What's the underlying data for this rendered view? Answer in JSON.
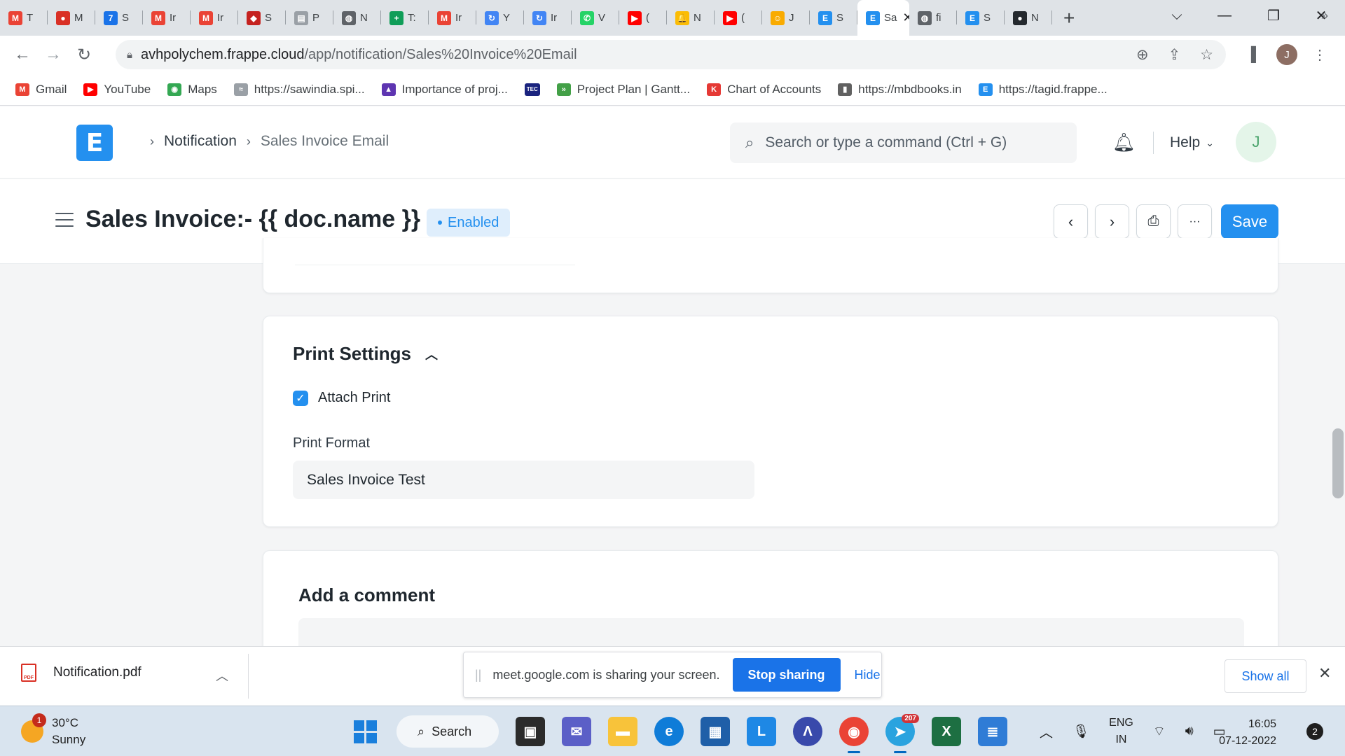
{
  "browser": {
    "tabs": [
      {
        "label": "T",
        "icon": "gmail-icon",
        "color": "#ea4335",
        "glyph": "M"
      },
      {
        "label": "M",
        "icon": "record-icon",
        "color": "#d93025",
        "glyph": "●"
      },
      {
        "label": "S",
        "icon": "calendar-icon",
        "color": "#1a73e8",
        "glyph": "7"
      },
      {
        "label": "Ir",
        "icon": "gmail-icon",
        "color": "#ea4335",
        "glyph": "M"
      },
      {
        "label": "Ir",
        "icon": "gmail-icon",
        "color": "#ea4335",
        "glyph": "M"
      },
      {
        "label": "S",
        "icon": "pin-icon",
        "color": "#c5221f",
        "glyph": "◆"
      },
      {
        "label": "P",
        "icon": "doc-icon",
        "color": "#9aa0a6",
        "glyph": "▤"
      },
      {
        "label": "N",
        "icon": "globe-icon",
        "color": "#5f6368",
        "glyph": "◍"
      },
      {
        "label": "T:",
        "icon": "plus-icon",
        "color": "#0f9d58",
        "glyph": "+"
      },
      {
        "label": "Ir",
        "icon": "gmail-icon",
        "color": "#ea4335",
        "glyph": "M"
      },
      {
        "label": "Y",
        "icon": "refresh-icon",
        "color": "#4285f4",
        "glyph": "↻"
      },
      {
        "label": "Ir",
        "icon": "refresh-icon",
        "color": "#4285f4",
        "glyph": "↻"
      },
      {
        "label": "V",
        "icon": "whatsapp-icon",
        "color": "#25d366",
        "glyph": "✆"
      },
      {
        "label": "(",
        "icon": "youtube-icon",
        "color": "#ff0000",
        "glyph": "▶"
      },
      {
        "label": "N",
        "icon": "bell-icon",
        "color": "#fbbc04",
        "glyph": "🔔"
      },
      {
        "label": "(",
        "icon": "youtube-icon",
        "color": "#ff0000",
        "glyph": "▶"
      },
      {
        "label": "J",
        "icon": "people-icon",
        "color": "#f9ab00",
        "glyph": "☺"
      },
      {
        "label": "S",
        "icon": "frappe-icon",
        "color": "#2490ef",
        "glyph": "E"
      },
      {
        "label": "Sa",
        "icon": "frappe-icon",
        "color": "#2490ef",
        "glyph": "E",
        "active": true
      },
      {
        "label": "fi",
        "icon": "globe-icon",
        "color": "#5f6368",
        "glyph": "◍"
      },
      {
        "label": "S",
        "icon": "frappe-icon",
        "color": "#2490ef",
        "glyph": "E"
      },
      {
        "label": "N",
        "icon": "github-icon",
        "color": "#24292e",
        "glyph": "●"
      }
    ],
    "url_host": "avhpolychem.frappe.cloud",
    "url_path": "/app/notification/Sales%20Invoice%20Email",
    "profile_initial": "J",
    "bookmarks": [
      {
        "label": "Gmail",
        "icon": "gmail-icon",
        "color": "#ea4335",
        "glyph": "M"
      },
      {
        "label": "YouTube",
        "icon": "youtube-icon",
        "color": "#ff0000",
        "glyph": "▶"
      },
      {
        "label": "Maps",
        "icon": "maps-icon",
        "color": "#34a853",
        "glyph": "◉"
      },
      {
        "label": "https://sawindia.spi...",
        "icon": "link-icon",
        "color": "#9aa0a6",
        "glyph": "≈"
      },
      {
        "label": "Importance of proj...",
        "icon": "chart-icon",
        "color": "#5e35b1",
        "glyph": "▲"
      },
      {
        "label": "",
        "icon": "tec-icon",
        "color": "#1a237e",
        "glyph": "TEC"
      },
      {
        "label": "Project Plan | Gantt...",
        "icon": "arrows-icon",
        "color": "#43a047",
        "glyph": "»"
      },
      {
        "label": "Chart of Accounts",
        "icon": "k-icon",
        "color": "#e53935",
        "glyph": "K"
      },
      {
        "label": "https://mbdbooks.in",
        "icon": "book-icon",
        "color": "#616161",
        "glyph": "▮"
      },
      {
        "label": "https://tagid.frappe...",
        "icon": "frappe-icon",
        "color": "#2490ef",
        "glyph": "E"
      }
    ]
  },
  "app": {
    "logo": "E",
    "breadcrumbs": [
      "Notification",
      "Sales Invoice Email"
    ],
    "search_placeholder": "Search or type a command (Ctrl + G)",
    "help_label": "Help",
    "user_initial": "J",
    "accent_color": "#2490ef"
  },
  "page": {
    "title": "Sales Invoice:- {{ doc.name }}",
    "status": "Enabled",
    "save_label": "Save",
    "more_label": "···"
  },
  "print_settings": {
    "title": "Print Settings",
    "attach_print_label": "Attach Print",
    "attach_print_checked": true,
    "print_format_label": "Print Format",
    "print_format_value": "Sales Invoice Test"
  },
  "comments": {
    "title": "Add a comment"
  },
  "download_shelf": {
    "file_name": "Notification.pdf",
    "share_message": "meet.google.com is sharing your screen.",
    "stop_sharing_label": "Stop sharing",
    "hide_label": "Hide",
    "show_all_label": "Show all"
  },
  "taskbar": {
    "temperature": "30°C",
    "condition": "Sunny",
    "weather_badge": "1",
    "search_label": "Search",
    "telegram_badge": "207",
    "language_line1": "ENG",
    "language_line2": "IN",
    "time": "16:05",
    "date": "07-12-2022",
    "notification_count": "2"
  }
}
